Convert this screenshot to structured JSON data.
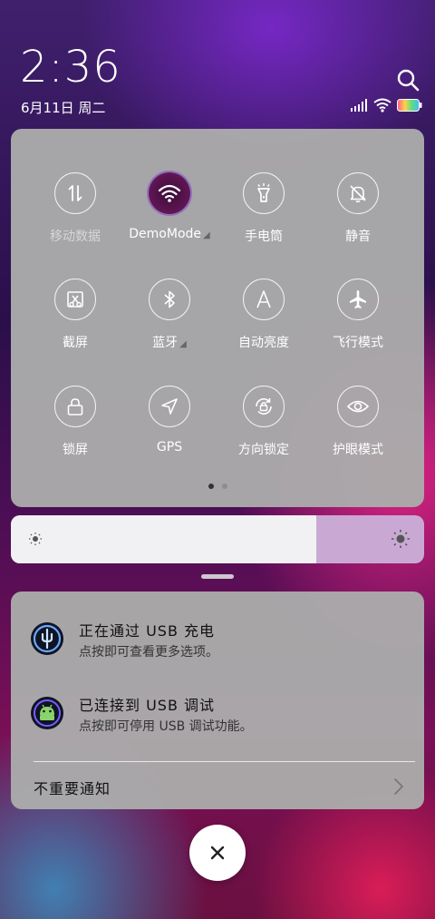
{
  "status": {
    "time": "2:36",
    "date": "6月11日 周二"
  },
  "quick_settings": {
    "tiles": [
      {
        "label": "移动数据",
        "icon": "mobile-data-icon",
        "enabled": false
      },
      {
        "label": "DemoMode",
        "icon": "wifi-icon",
        "enabled": true
      },
      {
        "label": "手电筒",
        "icon": "flashlight-icon",
        "enabled": true
      },
      {
        "label": "静音",
        "icon": "bell-off-icon",
        "enabled": true
      },
      {
        "label": "截屏",
        "icon": "screenshot-icon",
        "enabled": true
      },
      {
        "label": "蓝牙",
        "icon": "bluetooth-icon",
        "enabled": true
      },
      {
        "label": "自动亮度",
        "icon": "auto-brightness-icon",
        "enabled": true
      },
      {
        "label": "飞行模式",
        "icon": "airplane-icon",
        "enabled": true
      },
      {
        "label": "锁屏",
        "icon": "lock-icon",
        "enabled": true
      },
      {
        "label": "GPS",
        "icon": "location-icon",
        "enabled": true
      },
      {
        "label": "方向锁定",
        "icon": "rotation-lock-icon",
        "enabled": true
      },
      {
        "label": "护眼模式",
        "icon": "eye-icon",
        "enabled": true
      }
    ],
    "page_count": 2,
    "current_page": 1
  },
  "brightness": {
    "level": 0.74
  },
  "notifications": [
    {
      "title": "正在通过 USB 充电",
      "subtitle": "点按即可查看更多选项。",
      "icon": "usb-icon"
    },
    {
      "title": "已连接到 USB 调试",
      "subtitle": "点按即可停用 USB 调试功能。",
      "icon": "android-icon"
    }
  ],
  "unimportant_label": "不重要通知",
  "colors": {
    "accent": "#c9a9d4",
    "panel": "#aaaaaa"
  }
}
